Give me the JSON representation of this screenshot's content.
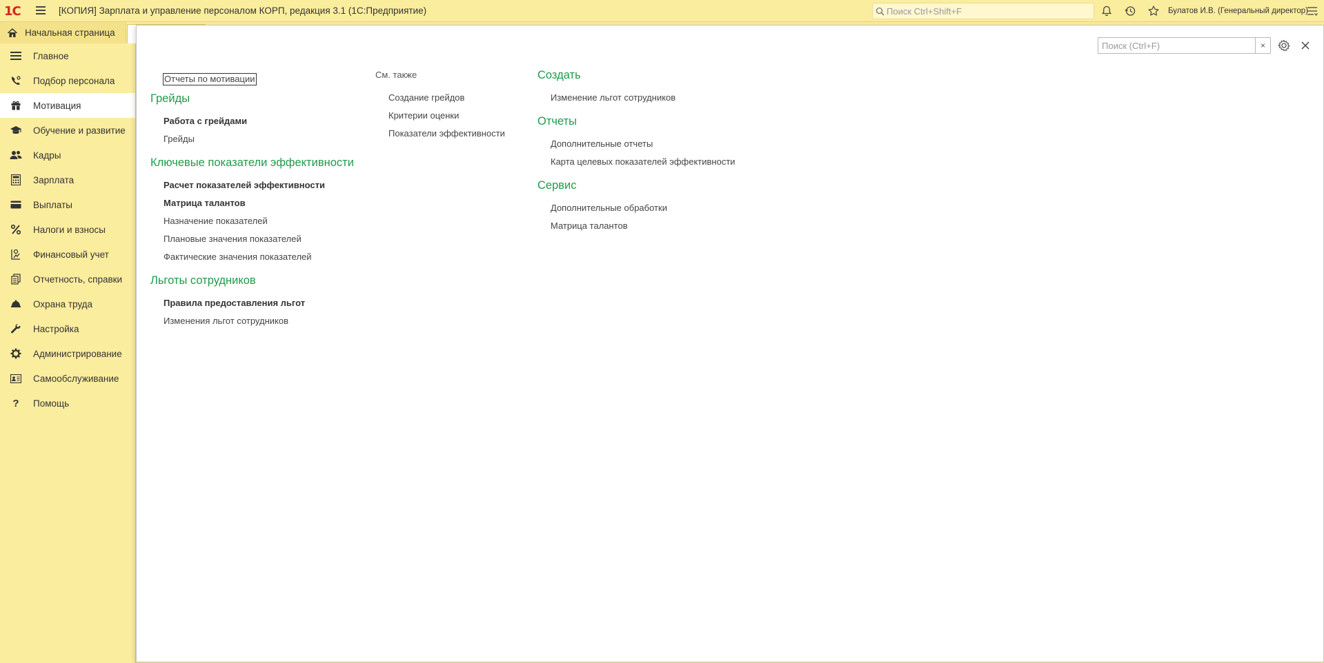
{
  "topbar": {
    "logo_text": "1С",
    "title": "[КОПИЯ] Зарплата и управление персоналом КОРП, редакция 3.1  (1С:Предприятие)",
    "search_placeholder": "Поиск Ctrl+Shift+F",
    "user": "Булатов И.В. (Генеральный директор)"
  },
  "tabs": {
    "home_label": "Начальная страница"
  },
  "sidebar": {
    "items": [
      {
        "label": "Главное",
        "icon": "menu-lines-icon"
      },
      {
        "label": "Подбор персонала",
        "icon": "phone-person-icon"
      },
      {
        "label": "Мотивация",
        "icon": "gift-icon"
      },
      {
        "label": "Обучение и развитие",
        "icon": "graduation-cap-icon"
      },
      {
        "label": "Кадры",
        "icon": "people-icon"
      },
      {
        "label": "Зарплата",
        "icon": "calculator-icon"
      },
      {
        "label": "Выплаты",
        "icon": "card-icon"
      },
      {
        "label": "Налоги и взносы",
        "icon": "percent-icon"
      },
      {
        "label": "Финансовый учет",
        "icon": "ledger-icon"
      },
      {
        "label": "Отчетность, справки",
        "icon": "reports-icon"
      },
      {
        "label": "Охрана труда",
        "icon": "helmet-icon"
      },
      {
        "label": "Настройка",
        "icon": "wrench-icon"
      },
      {
        "label": "Администрирование",
        "icon": "gear-icon"
      },
      {
        "label": "Самообслуживание",
        "icon": "id-card-icon"
      },
      {
        "label": "Помощь",
        "icon": "question-icon"
      }
    ],
    "active_index": 2
  },
  "panel": {
    "search_placeholder": "Поиск (Ctrl+F)",
    "col1": {
      "top_link": "Отчеты по мотивации",
      "sections": [
        {
          "title": "Грейды",
          "links": [
            {
              "label": "Работа с грейдами",
              "bold": true
            },
            {
              "label": "Грейды",
              "bold": false
            }
          ]
        },
        {
          "title": "Ключевые показатели эффективности",
          "links": [
            {
              "label": "Расчет показателей эффективности",
              "bold": true
            },
            {
              "label": "Матрица талантов",
              "bold": true
            },
            {
              "label": "Назначение показателей",
              "bold": false
            },
            {
              "label": "Плановые значения показателей",
              "bold": false
            },
            {
              "label": "Фактические значения показателей",
              "bold": false
            }
          ]
        },
        {
          "title": "Льготы сотрудников",
          "links": [
            {
              "label": "Правила предоставления льгот",
              "bold": true
            },
            {
              "label": "Изменения льгот сотрудников",
              "bold": false
            }
          ]
        }
      ]
    },
    "col2": {
      "title": "См. также",
      "links": [
        "Создание грейдов",
        "Критерии оценки",
        "Показатели эффективности"
      ]
    },
    "col3": {
      "sections": [
        {
          "title": "Создать",
          "links": [
            "Изменение льгот сотрудников"
          ]
        },
        {
          "title": "Отчеты",
          "links": [
            "Дополнительные отчеты",
            "Карта целевых показателей эффективности"
          ]
        },
        {
          "title": "Сервис",
          "links": [
            "Дополнительные обработки",
            "Матрица талантов"
          ]
        }
      ]
    }
  },
  "colors": {
    "accent_green": "#1f9b4a",
    "bar_yellow": "#fbed9e",
    "logo_red": "#d7261f"
  }
}
